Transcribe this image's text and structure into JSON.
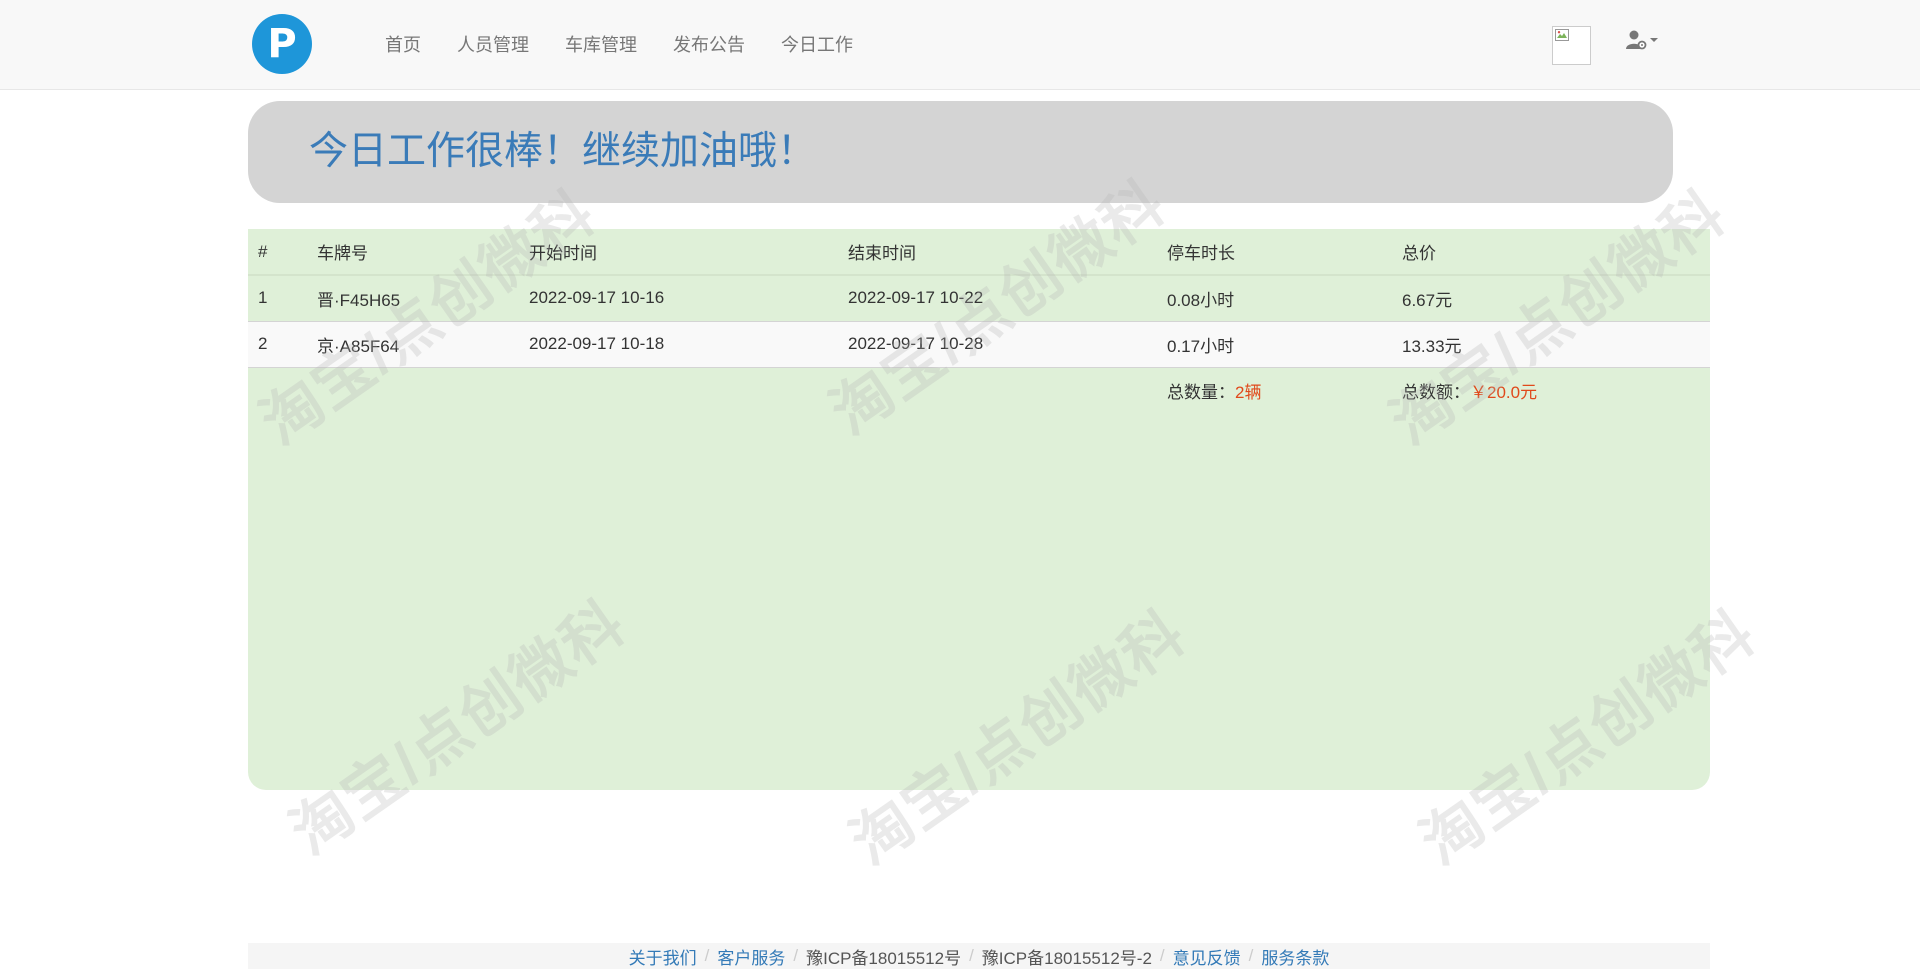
{
  "brand": {
    "logo_letter": "P"
  },
  "nav": {
    "items": [
      {
        "label": "首页"
      },
      {
        "label": "人员管理"
      },
      {
        "label": "车库管理"
      },
      {
        "label": "发布公告"
      },
      {
        "label": "今日工作"
      }
    ],
    "user_icon": "user-cog-icon",
    "avatar_icon": "broken-image-icon"
  },
  "jumbotron": {
    "heading": "今日工作很棒！继续加油哦！"
  },
  "table": {
    "headers": [
      "#",
      "车牌号",
      "开始时间",
      "结束时间",
      "停车时长",
      "总价"
    ],
    "rows": [
      {
        "idx": "1",
        "plate": "晋·F45H65",
        "start": "2022-09-17 10-16",
        "end": "2022-09-17 10-22",
        "duration": "0.08小时",
        "price": "6.67元"
      },
      {
        "idx": "2",
        "plate": "京·A85F64",
        "start": "2022-09-17 10-18",
        "end": "2022-09-17 10-28",
        "duration": "0.17小时",
        "price": "13.33元"
      }
    ],
    "summary": {
      "count_label": "总数量：",
      "count_value": "2辆",
      "amount_label": "总数额：",
      "amount_value": "￥20.0元"
    }
  },
  "watermark": {
    "text": "淘宝/点创微科"
  },
  "footer": {
    "links": [
      "关于我们",
      "客户服务",
      "豫ICP备18015512号",
      "豫ICP备18015512号-2",
      "意见反馈",
      "服务条款"
    ],
    "separator": "/"
  },
  "colors": {
    "accent": "#337ab7",
    "logo": "#1e96d9",
    "highlight": "#e0491b",
    "panel": "#dff0d8"
  }
}
